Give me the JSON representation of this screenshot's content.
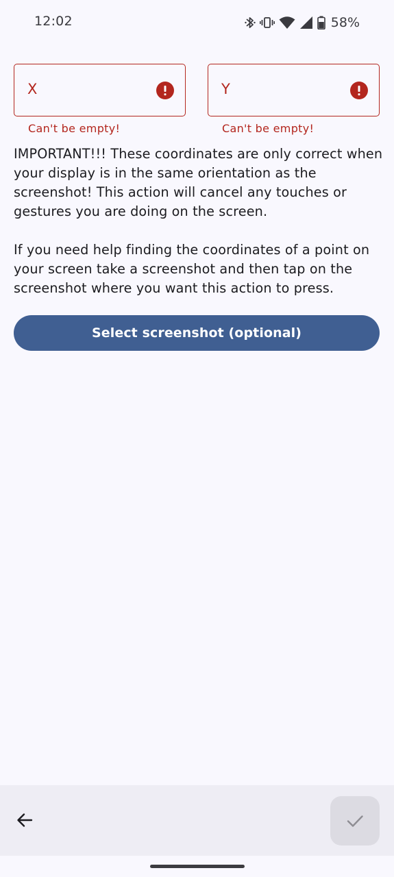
{
  "status_bar": {
    "time": "12:02",
    "battery_percent": "58%",
    "icons": [
      "bluetooth-icon",
      "vibrate-icon",
      "wifi-icon",
      "signal-icon",
      "battery-icon"
    ]
  },
  "fields": {
    "x": {
      "label": "X",
      "error": "Can't be empty!"
    },
    "y": {
      "label": "Y",
      "error": "Can't be empty!"
    }
  },
  "info": {
    "paragraph_1": "IMPORTANT!!! These coordinates are only correct when your display is in the same orientation as the screenshot! This action will cancel any touches or gestures you are doing on the screen.",
    "paragraph_2": "If you need help finding the coordinates of a point on your screen take a screenshot and then tap on the screenshot where you want this action to press."
  },
  "select_button": {
    "label": "Select screenshot (optional)"
  },
  "bottom_bar": {
    "back_icon": "arrow-left-icon",
    "confirm_icon": "check-icon"
  },
  "colors": {
    "error": "#b3261e",
    "primary": "#405f92",
    "background": "#f9f8fe",
    "bottom_bar": "#eeedf4",
    "fab_disabled": "#dcdbe2"
  }
}
